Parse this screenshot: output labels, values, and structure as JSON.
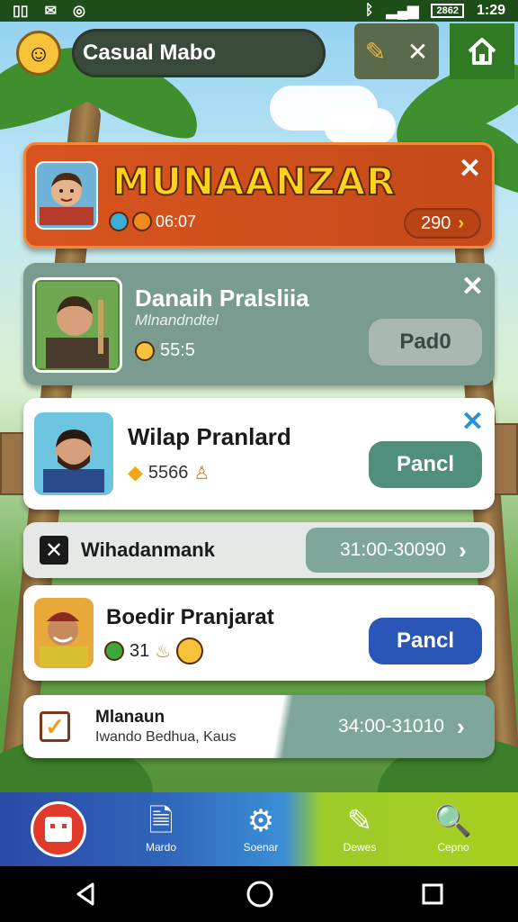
{
  "status_bar": {
    "time": "1:29",
    "battery": "2862"
  },
  "header": {
    "title": "Casual Mabo"
  },
  "featured": {
    "name": "MUNAANZAR",
    "time": "06:07",
    "score": "290"
  },
  "players": [
    {
      "name": "Danaih Pralsliia",
      "subtitle": "Mlnandndtel",
      "stat": "55:5",
      "button": "Pad0"
    },
    {
      "name": "Wilap Pranlard",
      "stat": "5566",
      "button": "Pancl"
    },
    {
      "name": "Boedir Pranjarat",
      "stat": "31",
      "button": "Pancl"
    }
  ],
  "rows": [
    {
      "title": "Wihadanmank",
      "range": "31:00-30090"
    },
    {
      "title": "Mlanaun",
      "subtitle": "Iwando Bedhua, Kaus",
      "range": "34:00-31010"
    }
  ],
  "nav": [
    {
      "label": ""
    },
    {
      "label": "Mardo"
    },
    {
      "label": "Soenar"
    },
    {
      "label": "Dewes"
    },
    {
      "label": "Cepno"
    }
  ],
  "colors": {
    "featured_bg": "#d9541e",
    "featured_name": "#ffd21f",
    "card_muted": "#7a9b8f",
    "button_green": "#4f8f7c",
    "button_blue": "#2a56b8",
    "close_blue": "#2a8fd6"
  }
}
